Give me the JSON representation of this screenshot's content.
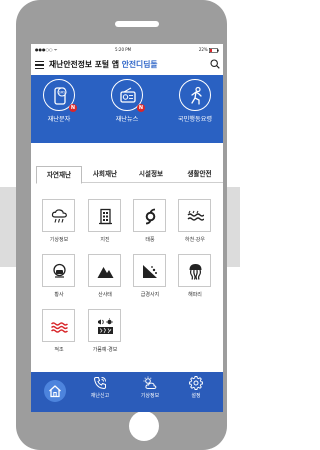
{
  "status_bar": {
    "carrier": "●●●○○ ᯤ",
    "time": "5:20 PM",
    "battery": "22%"
  },
  "app_bar": {
    "title_main": "재난안전정보 포털 앱 ",
    "title_accent": "안전디딤돌"
  },
  "quick_actions": [
    {
      "label": "재난문자",
      "icon": "sms-icon",
      "badge": "N"
    },
    {
      "label": "재난뉴스",
      "icon": "radio-icon",
      "badge": "N"
    },
    {
      "label": "국민행동요령",
      "icon": "running-person-icon",
      "badge": ""
    }
  ],
  "tabs": [
    {
      "label": "자연재난",
      "active": true
    },
    {
      "label": "사회재난",
      "active": false
    },
    {
      "label": "시설정보",
      "active": false
    },
    {
      "label": "생활안전",
      "active": false
    }
  ],
  "disaster_items": [
    {
      "label": "기상정보",
      "icon": "cloud-rain-icon"
    },
    {
      "label": "지진",
      "icon": "building-icon"
    },
    {
      "label": "태풍",
      "icon": "typhoon-icon"
    },
    {
      "label": "하천·강우",
      "icon": "water-waves-icon"
    },
    {
      "label": "황사",
      "icon": "mask-icon"
    },
    {
      "label": "산사태",
      "icon": "mountain-icon"
    },
    {
      "label": "급경사지",
      "icon": "slope-icon"
    },
    {
      "label": "해파리",
      "icon": "jellyfish-icon"
    },
    {
      "label": "적조",
      "icon": "red-tide-icon"
    },
    {
      "label": "가뭄예·경보",
      "icon": "drought-icon"
    }
  ],
  "bottom_nav": [
    {
      "label": "",
      "icon": "home-icon"
    },
    {
      "label": "재난신고",
      "icon": "phone-icon"
    },
    {
      "label": "기상정보",
      "icon": "weather-icon"
    },
    {
      "label": "설정",
      "icon": "gear-icon"
    }
  ],
  "colors": {
    "brand_blue": "#2a61c2",
    "nav_blue": "#2b5cba",
    "badge_red": "#d8262a",
    "red_tide": "#d8262a"
  }
}
